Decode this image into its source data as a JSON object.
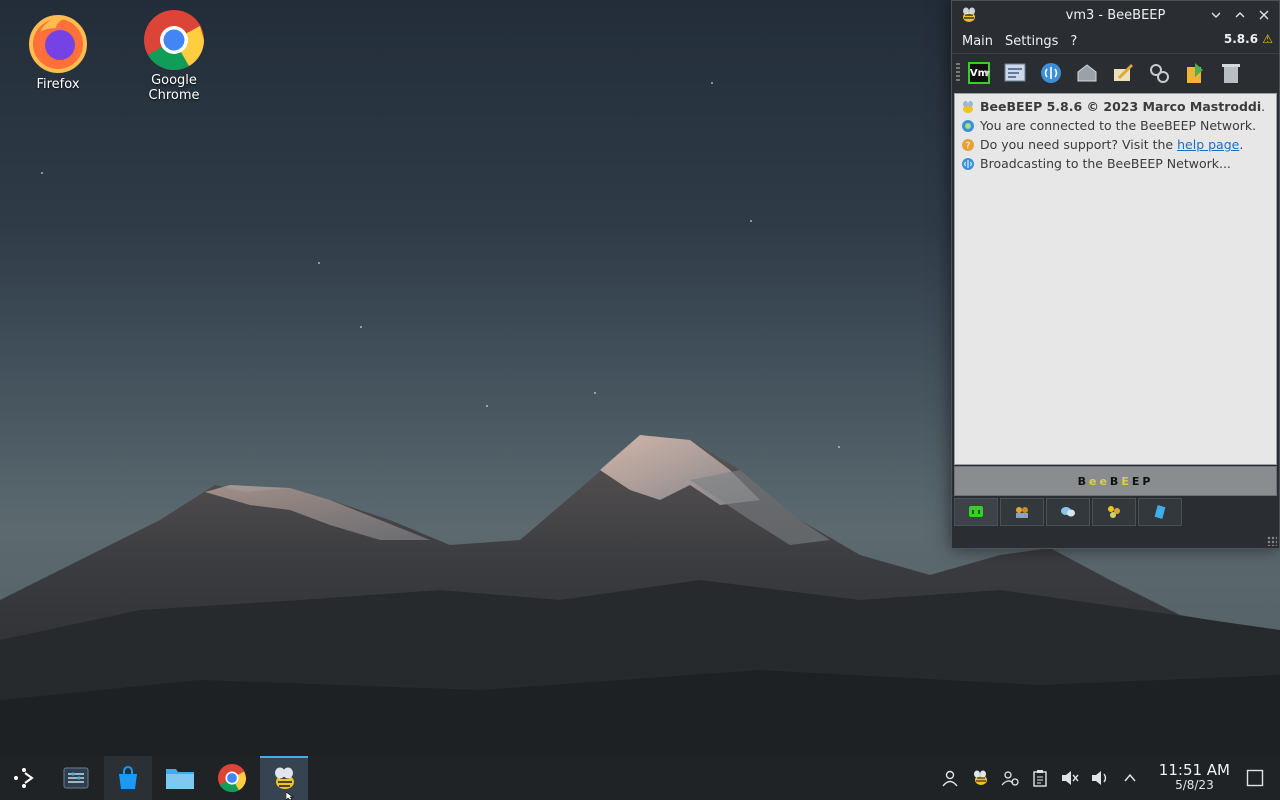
{
  "desktop": {
    "icons": [
      {
        "label": "Firefox",
        "icon": "firefox-icon"
      },
      {
        "label": "Google Chrome",
        "icon": "chrome-icon"
      }
    ]
  },
  "window": {
    "title": "vm3 - BeeBEEP",
    "app_icon": "beebeep-bee-icon",
    "controls": [
      "minimize-icon",
      "maximize-icon",
      "close-icon"
    ],
    "menu": [
      "Main",
      "Settings",
      "?"
    ],
    "version_badge": "5.8.6",
    "toolbar": {
      "vm_button_label": "Vm",
      "buttons": [
        "status-icon",
        "notes-icon",
        "broadcast-icon",
        "home-icon",
        "edit-icon",
        "plugins-icon",
        "share-icon",
        "trash-icon"
      ]
    },
    "chat": {
      "line1_app": "BeeBEEP 5.8.6 © 2023 Marco Mastroddi",
      "line1_end": ".",
      "line2": "You are connected to the BeeBEEP Network.",
      "line3_prefix": "Do you need support? Visit the ",
      "line3_link": "help page",
      "line3_end": ".",
      "line4": "Broadcasting to the BeeBEEP Network..."
    },
    "banner": "BeeBEEP",
    "bottom_tabs": [
      "chat-tab-icon",
      "users-tab-icon",
      "groups-tab-icon",
      "network-tab-icon",
      "files-tab-icon"
    ]
  },
  "taskbar": {
    "launchers": [
      "application-launcher-icon",
      "system-settings-icon",
      "discover-store-icon",
      "file-manager-icon",
      "chrome-icon",
      "beebeep-bee-icon"
    ],
    "tray": [
      "user-icon",
      "beebeep-tray-icon",
      "users-status-icon",
      "clipboard-icon",
      "mute-icon",
      "volume-icon",
      "expand-tray-icon"
    ],
    "time": "11:51 AM",
    "date": "5/8/23"
  },
  "colors": {
    "accent": "#3daee9",
    "link": "#1a6fc4",
    "vm_border": "#3ecb2d"
  }
}
